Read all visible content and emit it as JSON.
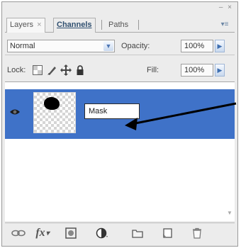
{
  "panel": {
    "tabs": [
      {
        "label": "Layers",
        "close": "×",
        "active": true
      },
      {
        "label": "Channels",
        "active": false
      },
      {
        "label": "Paths",
        "active": false
      }
    ],
    "title_controls": "– ×",
    "menu_icon": "panel-menu-icon"
  },
  "blend": {
    "mode": "Normal",
    "opacity_label": "Opacity:",
    "opacity_value": "100%"
  },
  "lock": {
    "label": "Lock:",
    "fill_label": "Fill:",
    "fill_value": "100%"
  },
  "layers": [
    {
      "name": "Mask",
      "visible": true,
      "selected": true,
      "editing_name": true
    }
  ],
  "footer": {
    "icons": [
      "link-layers-icon",
      "fx-icon",
      "add-mask-icon",
      "adjustment-layer-icon",
      "new-group-icon",
      "new-layer-icon",
      "delete-layer-icon"
    ],
    "fx_label": "fx"
  },
  "colors": {
    "selection": "#3f72c8",
    "accent": "#4d76b3"
  }
}
